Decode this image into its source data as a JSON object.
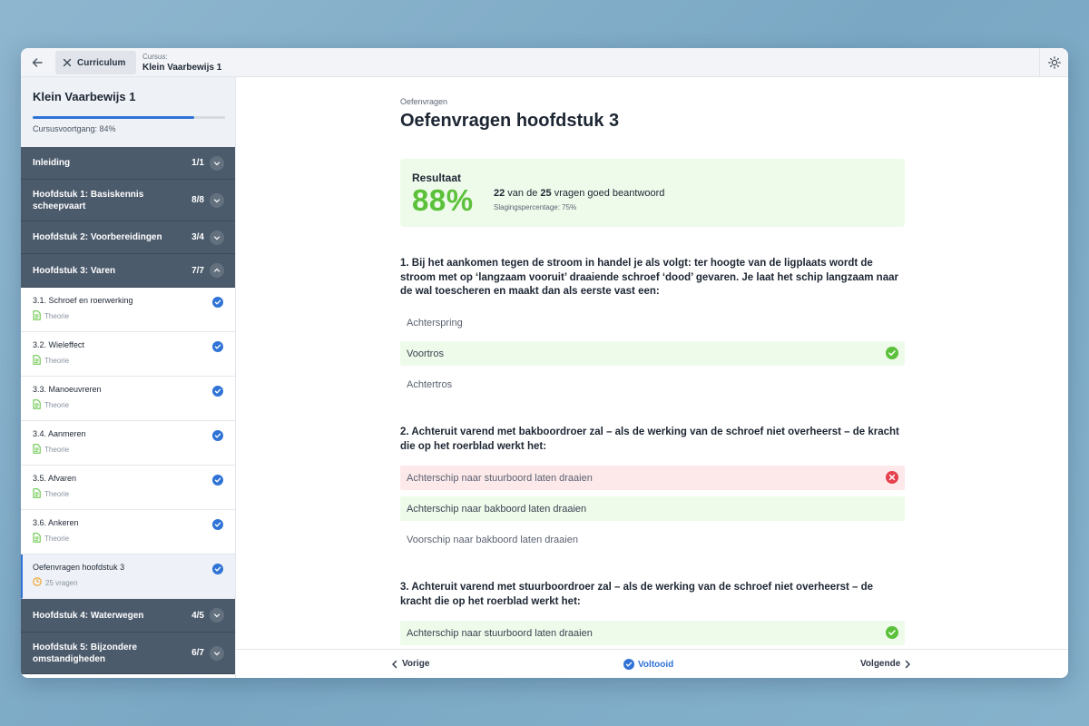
{
  "topbar": {
    "curriculum_label": "Curriculum",
    "course_label": "Cursus:",
    "course_name": "Klein Vaarbewijs 1"
  },
  "sidebar": {
    "title": "Klein Vaarbewijs 1",
    "progress_fraction": 0.84,
    "progress_text": "Cursusvoortgang: 84%",
    "chapters_top": [
      {
        "title": "Inleiding",
        "count": "1/1"
      },
      {
        "title": "Hoofdstuk 1: Basiskennis scheepvaart",
        "count": "8/8"
      },
      {
        "title": "Hoofdstuk 2: Voorbereidingen",
        "count": "3/4"
      },
      {
        "title": "Hoofdstuk 3: Varen",
        "count": "7/7"
      }
    ],
    "lessons": [
      {
        "title": "3.1. Schroef en roerwerking",
        "sub": "Theorie"
      },
      {
        "title": "3.2. Wieleffect",
        "sub": "Theorie"
      },
      {
        "title": "3.3. Manoeuvreren",
        "sub": "Theorie"
      },
      {
        "title": "3.4. Aanmeren",
        "sub": "Theorie"
      },
      {
        "title": "3.5. Afvaren",
        "sub": "Theorie"
      },
      {
        "title": "3.6. Ankeren",
        "sub": "Theorie"
      },
      {
        "title": "Oefenvragen hoofdstuk 3",
        "sub": "25 vragen"
      }
    ],
    "chapters_bottom": [
      {
        "title": "Hoofdstuk 4: Waterwegen",
        "count": "4/5"
      },
      {
        "title": "Hoofdstuk 5: Bijzondere omstandigheden",
        "count": "6/7"
      }
    ]
  },
  "main": {
    "eyebrow": "Oefenvragen",
    "title": "Oefenvragen hoofdstuk 3",
    "result": {
      "label": "Resultaat",
      "percent": "88%",
      "correct": "22",
      "mid1": " van de ",
      "total": "25",
      "mid2": " vragen goed beantwoord",
      "pass_rate": "Slagingspercentage: 75%"
    },
    "questions": [
      {
        "text": "1. Bij het aankomen tegen de stroom in handel je als volgt: ter hoogte van de ligplaats wordt de stroom met op ‘langzaam vooruit’ draaiende schroef ‘dood’ gevaren. Je laat het schip langzaam naar de wal toescheren en maakt dan als eerste vast een:",
        "options": [
          "Achterspring",
          "Voortros",
          "Achtertros"
        ]
      },
      {
        "text": "2. Achteruit varend met bakboordroer zal – als de werking van de schroef niet overheerst – de kracht die op het roerblad werkt het:",
        "options": [
          "Achterschip naar stuurboord laten draaien",
          "Achterschip naar bakboord laten draaien",
          "Voorschip naar bakboord laten draaien"
        ]
      },
      {
        "text": "3. Achteruit varend met stuurboordroer zal – als de werking van de schroef niet overheerst – de kracht die op het roerblad werkt het:",
        "options": [
          "Achterschip naar stuurboord laten draaien"
        ]
      }
    ]
  },
  "bottombar": {
    "prev": "Vorige",
    "done": "Voltooid",
    "next": "Volgende"
  },
  "colors": {
    "accent": "#2f73d6",
    "success": "#5bc13a",
    "error": "#e5424d",
    "chapter_bg": "#4c5b6c"
  }
}
